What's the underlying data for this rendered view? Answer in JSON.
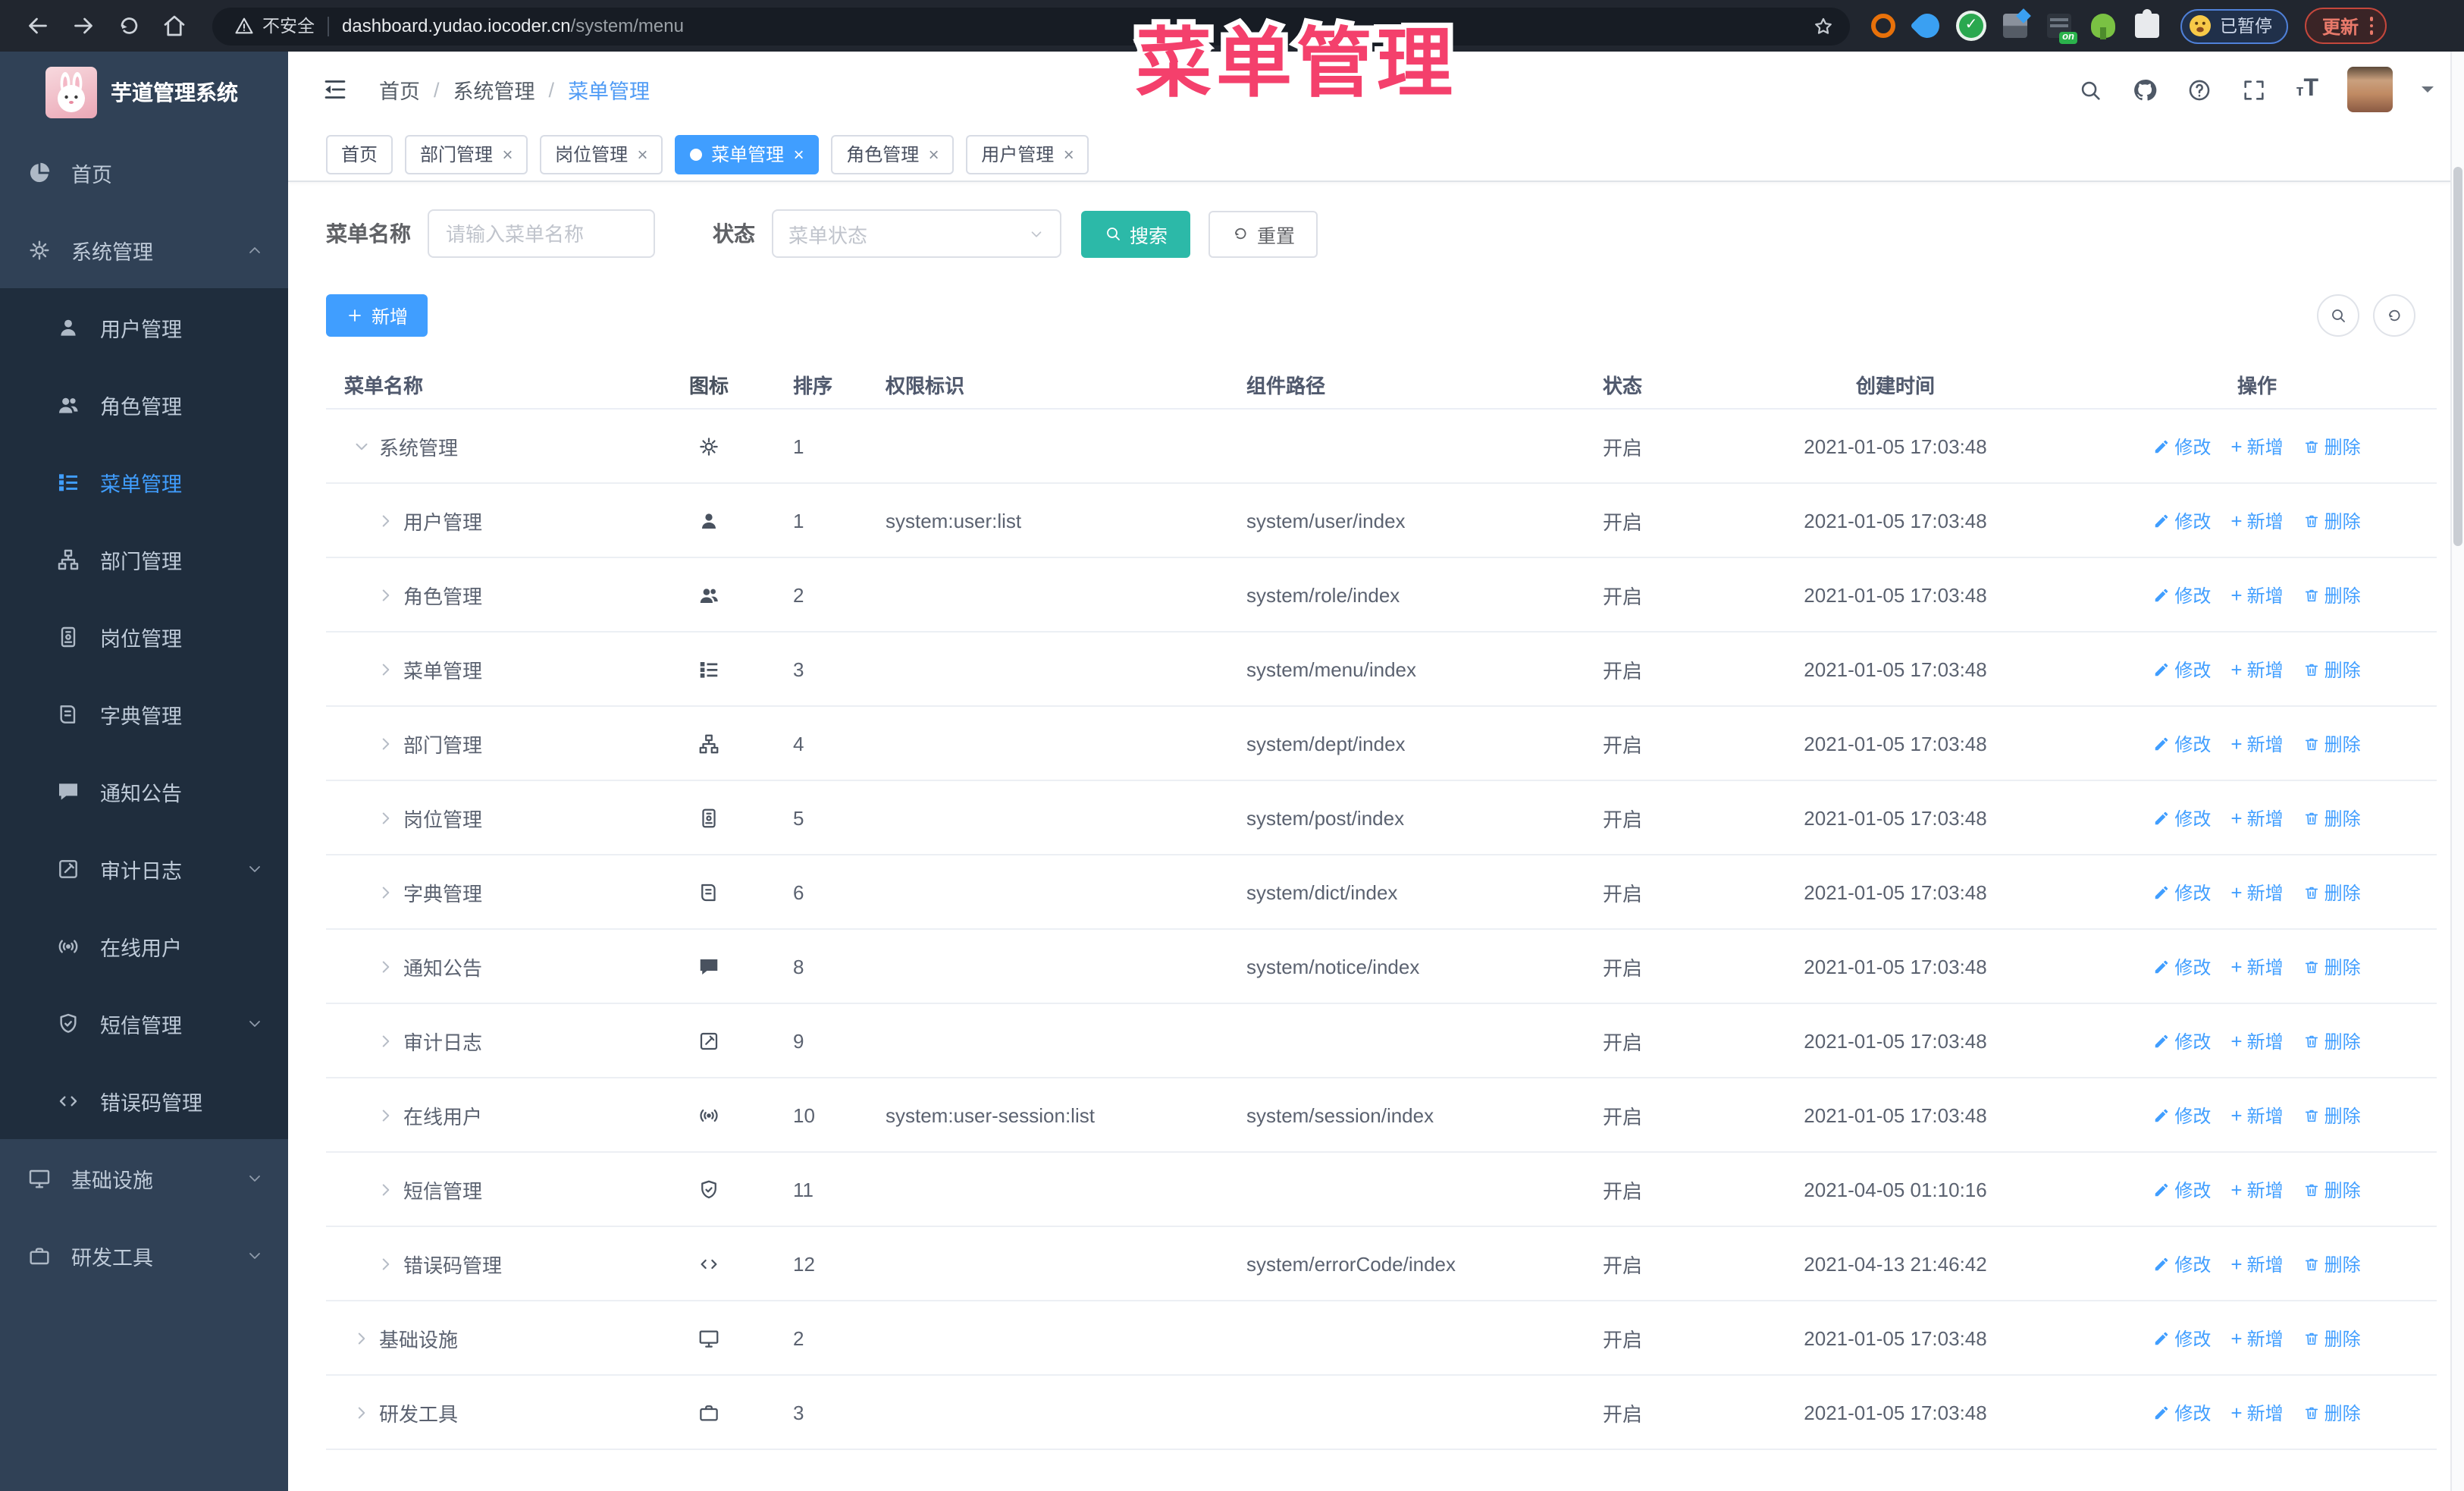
{
  "browser": {
    "security_label": "不安全",
    "url_host": "dashboard.yudao.iocoder.cn",
    "url_path": "/system/menu",
    "ext_on_label": "on",
    "paused_label": "已暂停",
    "update_label": "更新"
  },
  "overlay": {
    "title": "菜单管理"
  },
  "sidebar": {
    "app_title": "芋道管理系统",
    "items": [
      {
        "label": "首页",
        "icon": "dashboard-icon"
      },
      {
        "label": "系统管理",
        "icon": "gear-icon",
        "state": "expanded"
      },
      {
        "label": "基础设施",
        "icon": "monitor-icon",
        "state": "collapsed"
      },
      {
        "label": "研发工具",
        "icon": "toolbox-icon",
        "state": "collapsed"
      }
    ],
    "system_children": [
      {
        "label": "用户管理",
        "icon": "user-icon"
      },
      {
        "label": "角色管理",
        "icon": "users-icon"
      },
      {
        "label": "菜单管理",
        "icon": "menu-list-icon",
        "active": true
      },
      {
        "label": "部门管理",
        "icon": "org-tree-icon"
      },
      {
        "label": "岗位管理",
        "icon": "badge-icon"
      },
      {
        "label": "字典管理",
        "icon": "book-icon"
      },
      {
        "label": "通知公告",
        "icon": "chat-icon"
      },
      {
        "label": "审计日志",
        "icon": "edit-square-icon",
        "state": "collapsed"
      },
      {
        "label": "在线用户",
        "icon": "session-icon"
      },
      {
        "label": "短信管理",
        "icon": "shield-icon",
        "state": "collapsed"
      },
      {
        "label": "错误码管理",
        "icon": "code-icon"
      }
    ]
  },
  "header": {
    "breadcrumb": [
      "首页",
      "系统管理",
      "菜单管理"
    ],
    "font_icon_small": "т",
    "font_icon_large": "T"
  },
  "tabs": [
    {
      "label": "首页",
      "closable": false,
      "active": false
    },
    {
      "label": "部门管理",
      "closable": true,
      "active": false
    },
    {
      "label": "岗位管理",
      "closable": true,
      "active": false
    },
    {
      "label": "菜单管理",
      "closable": true,
      "active": true
    },
    {
      "label": "角色管理",
      "closable": true,
      "active": false
    },
    {
      "label": "用户管理",
      "closable": true,
      "active": false
    }
  ],
  "filters": {
    "name_label": "菜单名称",
    "name_placeholder": "请输入菜单名称",
    "status_label": "状态",
    "status_placeholder": "菜单状态",
    "search_label": "搜索",
    "reset_label": "重置"
  },
  "toolbar": {
    "add_label": "新增"
  },
  "row_actions": {
    "edit": "修改",
    "add": "新增",
    "delete": "删除"
  },
  "table": {
    "headers": [
      "菜单名称",
      "图标",
      "排序",
      "权限标识",
      "组件路径",
      "状态",
      "创建时间",
      "操作"
    ],
    "rows": [
      {
        "name": "系统管理",
        "icon": "gear-icon",
        "sort": "1",
        "perm": "",
        "path": "",
        "status": "开启",
        "time": "2021-01-05 17:03:48",
        "level": 0,
        "expanded": true
      },
      {
        "name": "用户管理",
        "icon": "user-icon",
        "sort": "1",
        "perm": "system:user:list",
        "path": "system/user/index",
        "status": "开启",
        "time": "2021-01-05 17:03:48",
        "level": 1
      },
      {
        "name": "角色管理",
        "icon": "users-icon",
        "sort": "2",
        "perm": "",
        "path": "system/role/index",
        "status": "开启",
        "time": "2021-01-05 17:03:48",
        "level": 1
      },
      {
        "name": "菜单管理",
        "icon": "menu-list-icon",
        "sort": "3",
        "perm": "",
        "path": "system/menu/index",
        "status": "开启",
        "time": "2021-01-05 17:03:48",
        "level": 1
      },
      {
        "name": "部门管理",
        "icon": "org-tree-icon",
        "sort": "4",
        "perm": "",
        "path": "system/dept/index",
        "status": "开启",
        "time": "2021-01-05 17:03:48",
        "level": 1
      },
      {
        "name": "岗位管理",
        "icon": "badge-icon",
        "sort": "5",
        "perm": "",
        "path": "system/post/index",
        "status": "开启",
        "time": "2021-01-05 17:03:48",
        "level": 1
      },
      {
        "name": "字典管理",
        "icon": "book-icon",
        "sort": "6",
        "perm": "",
        "path": "system/dict/index",
        "status": "开启",
        "time": "2021-01-05 17:03:48",
        "level": 1
      },
      {
        "name": "通知公告",
        "icon": "chat-icon",
        "sort": "8",
        "perm": "",
        "path": "system/notice/index",
        "status": "开启",
        "time": "2021-01-05 17:03:48",
        "level": 1
      },
      {
        "name": "审计日志",
        "icon": "edit-square-icon",
        "sort": "9",
        "perm": "",
        "path": "",
        "status": "开启",
        "time": "2021-01-05 17:03:48",
        "level": 1
      },
      {
        "name": "在线用户",
        "icon": "session-icon",
        "sort": "10",
        "perm": "system:user-session:list",
        "path": "system/session/index",
        "status": "开启",
        "time": "2021-01-05 17:03:48",
        "level": 1
      },
      {
        "name": "短信管理",
        "icon": "shield-icon",
        "sort": "11",
        "perm": "",
        "path": "",
        "status": "开启",
        "time": "2021-04-05 01:10:16",
        "level": 1
      },
      {
        "name": "错误码管理",
        "icon": "code-icon",
        "sort": "12",
        "perm": "",
        "path": "system/errorCode/index",
        "status": "开启",
        "time": "2021-04-13 21:46:42",
        "level": 1
      },
      {
        "name": "基础设施",
        "icon": "monitor-icon",
        "sort": "2",
        "perm": "",
        "path": "",
        "status": "开启",
        "time": "2021-01-05 17:03:48",
        "level": 0
      },
      {
        "name": "研发工具",
        "icon": "toolbox-icon",
        "sort": "3",
        "perm": "",
        "path": "",
        "status": "开启",
        "time": "2021-01-05 17:03:48",
        "level": 0
      }
    ]
  },
  "colors": {
    "primary": "#409eff",
    "search_teal": "#2cb9a8",
    "sidebar_bg": "#304156",
    "submenu_bg": "#1f2d3d",
    "overlay_pink": "#f4406c",
    "status_open": "开启"
  }
}
